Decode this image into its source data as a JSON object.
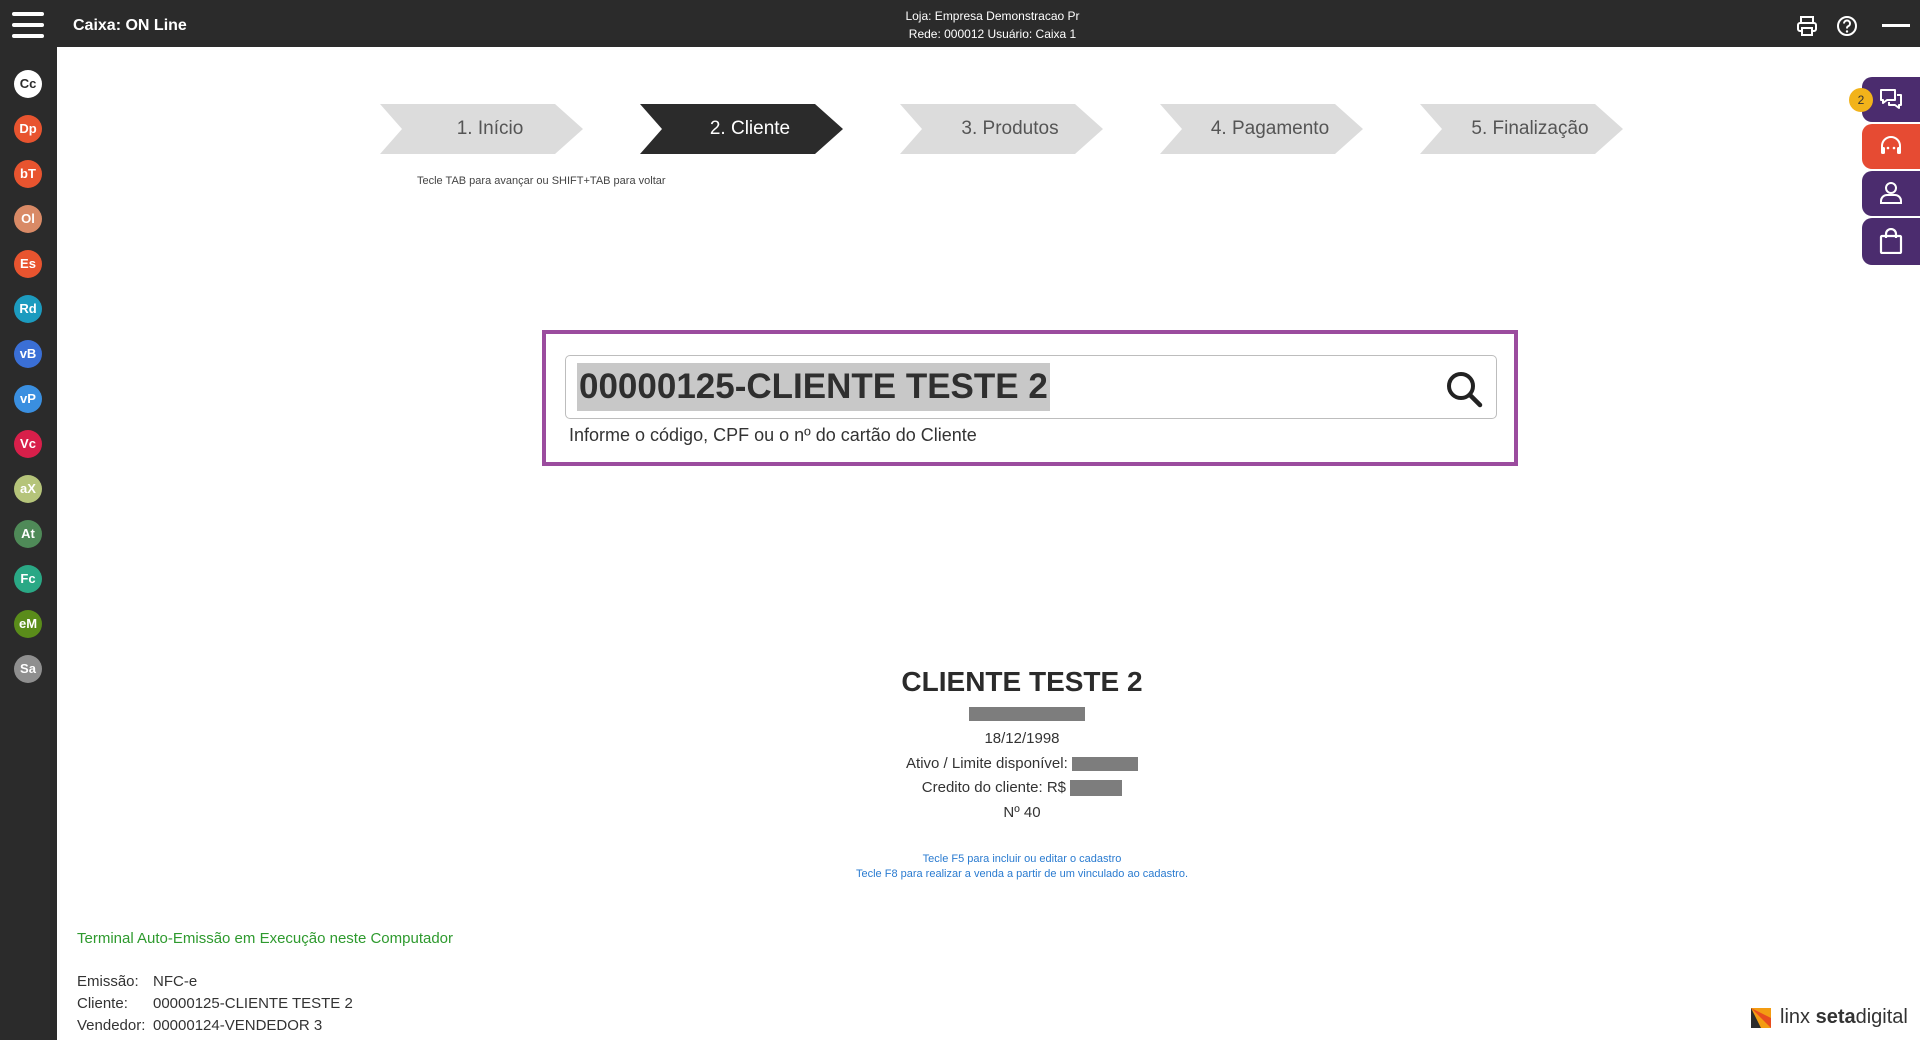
{
  "header": {
    "title": "Caixa: ON Line",
    "store_line": "Loja: Empresa Demonstracao Pr",
    "network_line": "Rede: 000012 Usuário: Caixa 1"
  },
  "sidebar": {
    "items": [
      {
        "label": "Cc",
        "color": "#ffffff",
        "text_color": "#2b2b2b"
      },
      {
        "label": "Dp",
        "color": "#e8542f"
      },
      {
        "label": "bT",
        "color": "#e8542f"
      },
      {
        "label": "Ol",
        "color": "#d98a66"
      },
      {
        "label": "Es",
        "color": "#e8542f"
      },
      {
        "label": "Rd",
        "color": "#1c9bbf"
      },
      {
        "label": "vB",
        "color": "#3a6fd6"
      },
      {
        "label": "vP",
        "color": "#3a8fe0"
      },
      {
        "label": "Vc",
        "color": "#d81f4a"
      },
      {
        "label": "aX",
        "color": "#b5c47a"
      },
      {
        "label": "At",
        "color": "#4f8a58"
      },
      {
        "label": "Fc",
        "color": "#2aa885"
      },
      {
        "label": "eM",
        "color": "#5a8c1a"
      },
      {
        "label": "Sa",
        "color": "#8f8f8f"
      }
    ]
  },
  "stepper": {
    "steps": [
      "1. Início",
      "2. Cliente",
      "3. Produtos",
      "4. Pagamento",
      "5. Finalização"
    ],
    "active_index": 1,
    "hint": "Tecle TAB para avançar ou SHIFT+TAB para voltar"
  },
  "search": {
    "value": "00000125-CLIENTE TESTE 2",
    "hint": "Informe o código, CPF ou o nº do cartão do Cliente"
  },
  "client": {
    "name": "CLIENTE TESTE 2",
    "birth_date": "18/12/1998",
    "status_label": "Ativo / Limite disponível:",
    "credit_label": "Credito do cliente: R$",
    "number": "Nº 40",
    "f5_hint": "Tecle F5 para incluir ou editar o cadastro",
    "f8_hint": "Tecle F8 para realizar a venda a partir de um vinculado ao cadastro."
  },
  "footer": {
    "terminal_status": "Terminal Auto-Emissão em Execução neste Computador",
    "emissao_label": "Emissão:",
    "emissao_value": "NFC-e",
    "cliente_label": "Cliente:",
    "cliente_value": "00000125-CLIENTE TESTE 2",
    "vendedor_label": "Vendedor:",
    "vendedor_value": "00000124-VENDEDOR 3"
  },
  "brand": {
    "prefix": "linx ",
    "bold": "seta",
    "suffix": "digital"
  },
  "right_panel": {
    "chat_badge": "2"
  },
  "colors": {
    "topbar": "#2b2b2b",
    "accent_frame": "#9b4c9e",
    "panel_purple": "#4b2c6e",
    "panel_orange": "#e64b33",
    "status_green": "#2e9a2e",
    "hint_blue": "#2a7bd0"
  }
}
